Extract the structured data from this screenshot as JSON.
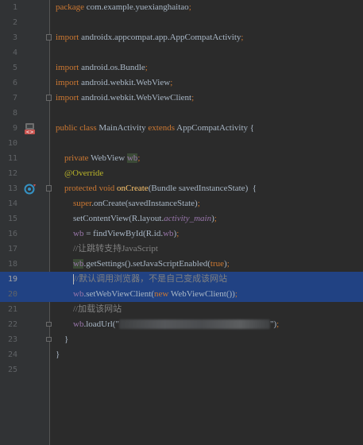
{
  "editor": {
    "lines": [
      {
        "n": "1",
        "tokens": [
          {
            "c": "kw",
            "t": "package "
          },
          {
            "c": "pl",
            "t": "com.example.yuexianghaitao"
          },
          {
            "c": "kw",
            "t": ";"
          }
        ]
      },
      {
        "n": "2",
        "tokens": []
      },
      {
        "n": "3",
        "tokens": [
          {
            "c": "kw",
            "t": "import "
          },
          {
            "c": "pl",
            "t": "androidx.appcompat.app.AppCompatActivity"
          },
          {
            "c": "kw",
            "t": ";"
          }
        ]
      },
      {
        "n": "4",
        "tokens": []
      },
      {
        "n": "5",
        "tokens": [
          {
            "c": "kw",
            "t": "import "
          },
          {
            "c": "pl",
            "t": "android.os.Bundle"
          },
          {
            "c": "kw",
            "t": ";"
          }
        ]
      },
      {
        "n": "6",
        "tokens": [
          {
            "c": "kw",
            "t": "import "
          },
          {
            "c": "pl",
            "t": "android.webkit.WebView"
          },
          {
            "c": "kw",
            "t": ";"
          }
        ]
      },
      {
        "n": "7",
        "tokens": [
          {
            "c": "kw",
            "t": "import "
          },
          {
            "c": "pl",
            "t": "android.webkit.WebViewClient"
          },
          {
            "c": "kw",
            "t": ";"
          }
        ]
      },
      {
        "n": "8",
        "tokens": []
      },
      {
        "n": "9",
        "tokens": [
          {
            "c": "kw",
            "t": "public class "
          },
          {
            "c": "pl",
            "t": "MainActivity "
          },
          {
            "c": "kw",
            "t": "extends "
          },
          {
            "c": "pl",
            "t": "AppCompatActivity {"
          }
        ]
      },
      {
        "n": "10",
        "tokens": []
      },
      {
        "n": "11",
        "tokens": [
          {
            "c": "pl",
            "t": "    "
          },
          {
            "c": "kw",
            "t": "private "
          },
          {
            "c": "pl",
            "t": "WebView "
          },
          {
            "c": "fld hl-bg",
            "t": "wb"
          },
          {
            "c": "kw",
            "t": ";"
          }
        ]
      },
      {
        "n": "12",
        "tokens": [
          {
            "c": "pl",
            "t": "    "
          },
          {
            "c": "ann",
            "t": "@Override"
          }
        ]
      },
      {
        "n": "13",
        "tokens": [
          {
            "c": "pl",
            "t": "    "
          },
          {
            "c": "kw",
            "t": "protected void "
          },
          {
            "c": "fn",
            "t": "onCreate"
          },
          {
            "c": "pl",
            "t": "(Bundle savedInstanceState)  {"
          }
        ]
      },
      {
        "n": "14",
        "tokens": [
          {
            "c": "pl",
            "t": "        "
          },
          {
            "c": "kw",
            "t": "super"
          },
          {
            "c": "pl",
            "t": ".onCreate(savedInstanceState)"
          },
          {
            "c": "kw",
            "t": ";"
          }
        ]
      },
      {
        "n": "15",
        "tokens": [
          {
            "c": "pl",
            "t": "        setContentView(R.layout."
          },
          {
            "c": "fldi",
            "t": "activity_main"
          },
          {
            "c": "pl",
            "t": ")"
          },
          {
            "c": "kw",
            "t": ";"
          }
        ]
      },
      {
        "n": "16",
        "tokens": [
          {
            "c": "pl",
            "t": "        "
          },
          {
            "c": "fld",
            "t": "wb "
          },
          {
            "c": "pl",
            "t": "= findViewById(R.id."
          },
          {
            "c": "fld",
            "t": "wb"
          },
          {
            "c": "pl",
            "t": ")"
          },
          {
            "c": "kw",
            "t": ";"
          }
        ]
      },
      {
        "n": "17",
        "tokens": [
          {
            "c": "pl",
            "t": "        "
          },
          {
            "c": "cmt",
            "t": "//让跳转支持JavaScript"
          }
        ]
      },
      {
        "n": "18",
        "tokens": [
          {
            "c": "pl",
            "t": "        "
          },
          {
            "c": "fld hl-bg",
            "t": "wb"
          },
          {
            "c": "pl",
            "t": ".getSettings().setJavaScriptEnabled("
          },
          {
            "c": "kw",
            "t": "true"
          },
          {
            "c": "pl",
            "t": ")"
          },
          {
            "c": "kw",
            "t": ";"
          }
        ]
      },
      {
        "n": "19",
        "tokens": [
          {
            "c": "pl",
            "t": "        "
          },
          {
            "c": "cmt",
            "t": "//默认调用浏览器，不是自己变成该网站"
          }
        ]
      },
      {
        "n": "20",
        "tokens": [
          {
            "c": "pl",
            "t": "        "
          },
          {
            "c": "fld",
            "t": "wb"
          },
          {
            "c": "pl",
            "t": ".setWebViewClient("
          },
          {
            "c": "kw",
            "t": "new "
          },
          {
            "c": "pl",
            "t": "WebViewClient())"
          },
          {
            "c": "kw",
            "t": ";"
          }
        ]
      },
      {
        "n": "21",
        "tokens": [
          {
            "c": "pl",
            "t": "        "
          },
          {
            "c": "cmt",
            "t": "//加载该网站"
          }
        ]
      },
      {
        "n": "22",
        "tokens": [
          {
            "c": "pl",
            "t": "        "
          },
          {
            "c": "fld",
            "t": "wb"
          },
          {
            "c": "pl",
            "t": ".loadUrl(\""
          },
          {
            "c": "blur",
            "t": ""
          },
          {
            "c": "pl",
            "t": "\")"
          },
          {
            "c": "kw",
            "t": ";"
          }
        ]
      },
      {
        "n": "23",
        "tokens": [
          {
            "c": "pl",
            "t": "    }"
          }
        ]
      },
      {
        "n": "24",
        "tokens": [
          {
            "c": "pl",
            "t": "}"
          }
        ]
      },
      {
        "n": "25",
        "tokens": []
      }
    ],
    "current_line": "19",
    "selection_lines": [
      "19",
      "20"
    ],
    "gutter_icons": [
      {
        "line": "9",
        "name": "android-activity-icon"
      },
      {
        "line": "13",
        "name": "override-method-icon"
      }
    ],
    "fold_lines": [
      "3",
      "7",
      "13",
      "22",
      "23"
    ]
  },
  "colors": {
    "background": "#2b2b2b",
    "gutter": "#313335",
    "selection": "#214283",
    "keyword": "#cc7832",
    "plain": "#a9b7c6",
    "field": "#9876aa",
    "method": "#ffc66d",
    "annotation": "#bbb529",
    "comment": "#808080"
  }
}
